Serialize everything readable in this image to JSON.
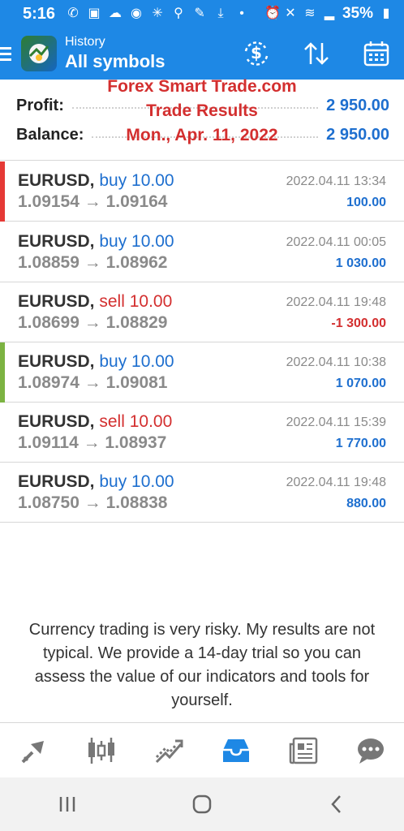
{
  "status_bar": {
    "time": "5:16",
    "battery": "35%",
    "left_icons": [
      "whatsapp-icon",
      "app-icon",
      "cloud-icon",
      "circle-icon",
      "spark-icon",
      "location-icon",
      "wrench-icon",
      "download-icon",
      "dot-icon"
    ],
    "right_icons": [
      "alarm-icon",
      "mute-icon",
      "nfc-icon",
      "signal-icon",
      "battery-icon"
    ]
  },
  "app_bar": {
    "subtitle": "History",
    "title": "All symbols",
    "actions": [
      "currency-exchange-icon",
      "sort-icon",
      "calendar-icon"
    ]
  },
  "overlay": {
    "line1": "Forex Smart Trade.com",
    "line2": "Trade Results",
    "line3": "Mon., Apr. 11, 2022"
  },
  "summary": {
    "profit_label": "Profit:",
    "profit_value": "2 950.00",
    "balance_label": "Balance:",
    "balance_value": "2 950.00"
  },
  "trades": [
    {
      "symbol": "EURUSD,",
      "side": "buy 10.00",
      "prices": "1.09154 → 1.09164",
      "date": "2022.04.11 13:34",
      "pl": "100.00",
      "side_color": "#1e6fcf",
      "pl_color": "#1e6fcf",
      "marker": "#e53935"
    },
    {
      "symbol": "EURUSD,",
      "side": "buy 10.00",
      "prices": "1.08859 → 1.08962",
      "date": "2022.04.11 00:05",
      "pl": "1 030.00",
      "side_color": "#1e6fcf",
      "pl_color": "#1e6fcf",
      "marker": ""
    },
    {
      "symbol": "EURUSD,",
      "side": "sell 10.00",
      "prices": "1.08699 → 1.08829",
      "date": "2022.04.11 19:48",
      "pl": "-1 300.00",
      "side_color": "#d32f2f",
      "pl_color": "#d32f2f",
      "marker": ""
    },
    {
      "symbol": "EURUSD,",
      "side": "buy 10.00",
      "prices": "1.08974 → 1.09081",
      "date": "2022.04.11 10:38",
      "pl": "1 070.00",
      "side_color": "#1e6fcf",
      "pl_color": "#1e6fcf",
      "marker": "#7cb342"
    },
    {
      "symbol": "EURUSD,",
      "side": "sell 10.00",
      "prices": "1.09114 → 1.08937",
      "date": "2022.04.11 15:39",
      "pl": "1 770.00",
      "side_color": "#d32f2f",
      "pl_color": "#1e6fcf",
      "marker": ""
    },
    {
      "symbol": "EURUSD,",
      "side": "buy 10.00",
      "prices": "1.08750 → 1.08838",
      "date": "2022.04.11 19:48",
      "pl": "880.00",
      "side_color": "#1e6fcf",
      "pl_color": "#1e6fcf",
      "marker": ""
    }
  ],
  "disclaimer": "Currency trading is very risky. My results are not typical. We provide a 14-day trial so you can assess the value of our indicators and tools for yourself.",
  "bottom_nav": [
    "quotes-icon",
    "chart-icon",
    "trade-icon",
    "history-icon",
    "news-icon",
    "chat-icon"
  ],
  "system_nav": [
    "recent-apps-icon",
    "home-icon",
    "back-icon"
  ],
  "colors": {
    "accent": "#1e88e5",
    "profit": "#1e6fcf",
    "loss": "#d32f2f"
  }
}
